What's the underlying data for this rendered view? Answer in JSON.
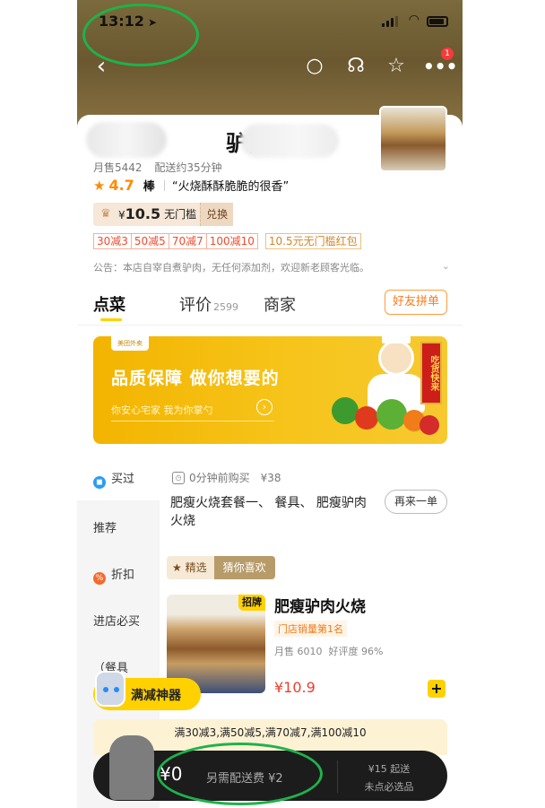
{
  "status_bar": {
    "time": "13:12",
    "location_arrow": "➤"
  },
  "nav": {
    "back_icon": "‹",
    "search_icon": "○",
    "service_icon": "☊",
    "star_icon": "☆",
    "more_icon": "•••",
    "more_badge": "1"
  },
  "shop": {
    "name": "驴肉火烧",
    "monthly_sales": "月售5442",
    "delivery_time": "配送约35分钟",
    "rating": "4.7",
    "rating_word": "棒",
    "review_quote": "“火烧酥酥脆脆的很香”",
    "notice": "公告：本店自宰自煮驴肉，无任何添加剂，欢迎新老顾客光临。"
  },
  "coupon": {
    "price_symbol": "¥",
    "price": "10.5",
    "condition": "无门槛",
    "redeem_label": "兑换"
  },
  "promos": [
    "30减3",
    "50减5",
    "70减7",
    "100减10"
  ],
  "red_packet": "10.5元无门槛红包",
  "tabs": {
    "order": "点菜",
    "reviews": "评价",
    "reviews_count": "2599",
    "merchant": "商家",
    "group_order": "好友拼单"
  },
  "banner": {
    "logo": "美团外卖",
    "title": "品质保障 做你想要的",
    "subtitle": "你安心宅家  我为你掌勺",
    "arrow": "›",
    "scroll_text": "吃货快来"
  },
  "sidebar": {
    "items": [
      {
        "label": "买过",
        "icon": "bag-icon"
      },
      {
        "label": "推荐"
      },
      {
        "label": "折扣",
        "icon": "discount-icon"
      },
      {
        "label": "进店必买"
      },
      {
        "label": "（餐具"
      }
    ]
  },
  "recent": {
    "time_text": "0分钟前购买",
    "price": "¥38",
    "items": "肥瘦火烧套餐一、 餐具、 肥瘦驴肉火烧",
    "reorder_label": "再来一单"
  },
  "picks": {
    "selected": "精选",
    "guess": "猜你喜欢"
  },
  "dish": {
    "tag": "招牌",
    "name": "肥瘦驴肉火烧",
    "rank": "门店销量第1名",
    "monthly": "月售 6010",
    "rating": "好评度 96%",
    "price": "¥10.9",
    "add": "+"
  },
  "robot": {
    "label": "满减神器"
  },
  "discount_bar": "满30减3,满50减5,满70减7,满100减10",
  "cart": {
    "total": "¥0",
    "extra": "另需配送费 ¥2",
    "min_order": "¥15 起送",
    "must_select": "未点必选品"
  },
  "colors": {
    "accent": "#ffd100",
    "annotation": "#1fb24a",
    "price": "#f03d2c",
    "rating": "#ff8a00"
  }
}
